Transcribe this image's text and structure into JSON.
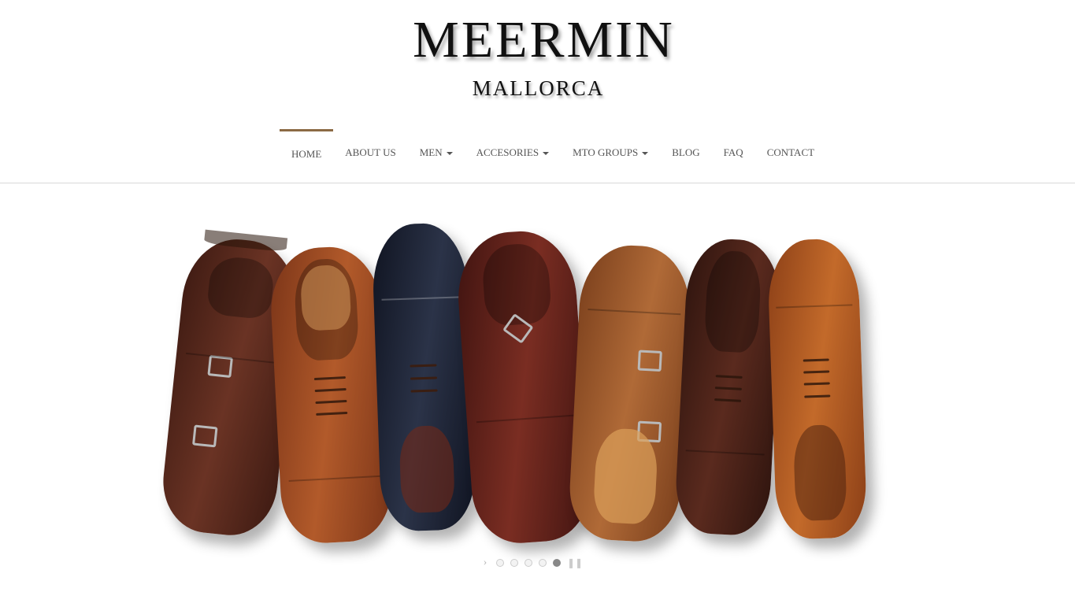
{
  "brand": {
    "name": "MEERMIN",
    "location": "MALLORCA"
  },
  "nav": {
    "items": [
      {
        "label": "HOME",
        "active": true,
        "dropdown": false
      },
      {
        "label": "ABOUT US",
        "active": false,
        "dropdown": false
      },
      {
        "label": "MEN",
        "active": false,
        "dropdown": true
      },
      {
        "label": "ACCESORIES",
        "active": false,
        "dropdown": true
      },
      {
        "label": "MTO GROUPS",
        "active": false,
        "dropdown": true
      },
      {
        "label": "BLOG",
        "active": false,
        "dropdown": false
      },
      {
        "label": "FAQ",
        "active": false,
        "dropdown": false
      },
      {
        "label": "CONTACT",
        "active": false,
        "dropdown": false
      }
    ],
    "accent_color": "#8b6a44",
    "text_color": "#555555"
  },
  "slider": {
    "slide_count": 5,
    "active_slide": 5,
    "image_alt": "",
    "shoes": [
      {
        "color": "#5a2a1e",
        "style": "double-monk",
        "buckles": true
      },
      {
        "color": "#9a4a23",
        "style": "oxford",
        "buckles": false
      },
      {
        "color": "#1d2233",
        "style": "brogue-oxford",
        "buckles": false
      },
      {
        "color": "#5e1f16",
        "style": "single-monk",
        "buckles": true
      },
      {
        "color": "#a0592e",
        "style": "suede-double-monk",
        "buckles": true
      },
      {
        "color": "#4a2219",
        "style": "split-toe-derby",
        "buckles": false
      },
      {
        "color": "#b85c26",
        "style": "brogue-oxford",
        "buckles": false
      }
    ],
    "icons": {
      "prev": "chevron-right-icon",
      "pause": "pause-icon"
    }
  }
}
